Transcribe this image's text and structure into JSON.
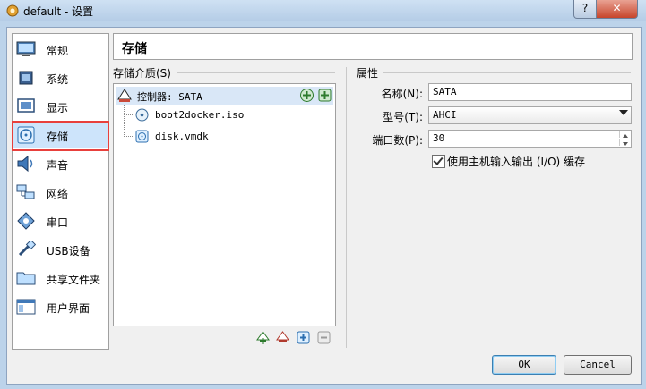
{
  "window": {
    "title": "default - 设置",
    "help_label": "?",
    "close_label": "✕"
  },
  "nav": {
    "items": [
      {
        "label": "常规",
        "icon": "monitor-icon"
      },
      {
        "label": "系统",
        "icon": "chip-icon"
      },
      {
        "label": "显示",
        "icon": "display-icon"
      },
      {
        "label": "存储",
        "icon": "storage-disc-icon",
        "selected": true
      },
      {
        "label": "声音",
        "icon": "speaker-icon"
      },
      {
        "label": "网络",
        "icon": "network-icon"
      },
      {
        "label": "串口",
        "icon": "serial-port-icon"
      },
      {
        "label": "USB设备",
        "icon": "usb-icon"
      },
      {
        "label": "共享文件夹",
        "icon": "folder-icon"
      },
      {
        "label": "用户界面",
        "icon": "window-icon"
      }
    ]
  },
  "page": {
    "title": "存储"
  },
  "storage": {
    "section_label": "存储介质(S)",
    "controller": {
      "label": "控制器: SATA"
    },
    "devices": [
      {
        "label": "boot2docker.iso",
        "icon": "optical-disc-icon"
      },
      {
        "label": "disk.vmdk",
        "icon": "hard-disk-icon"
      }
    ]
  },
  "attributes": {
    "section_label": "属性",
    "name_label": "名称(N):",
    "name_value": "SATA",
    "type_label": "型号(T):",
    "type_value": "AHCI",
    "ports_label": "端口数(P):",
    "ports_value": "30",
    "host_cache_label": "使用主机输入输出 (I/O) 缓存",
    "host_cache_checked": true
  },
  "buttons": {
    "ok": "OK",
    "cancel": "Cancel"
  },
  "colors": {
    "selected_border": "#e8403c",
    "selected_bg": "#cde4fb"
  }
}
